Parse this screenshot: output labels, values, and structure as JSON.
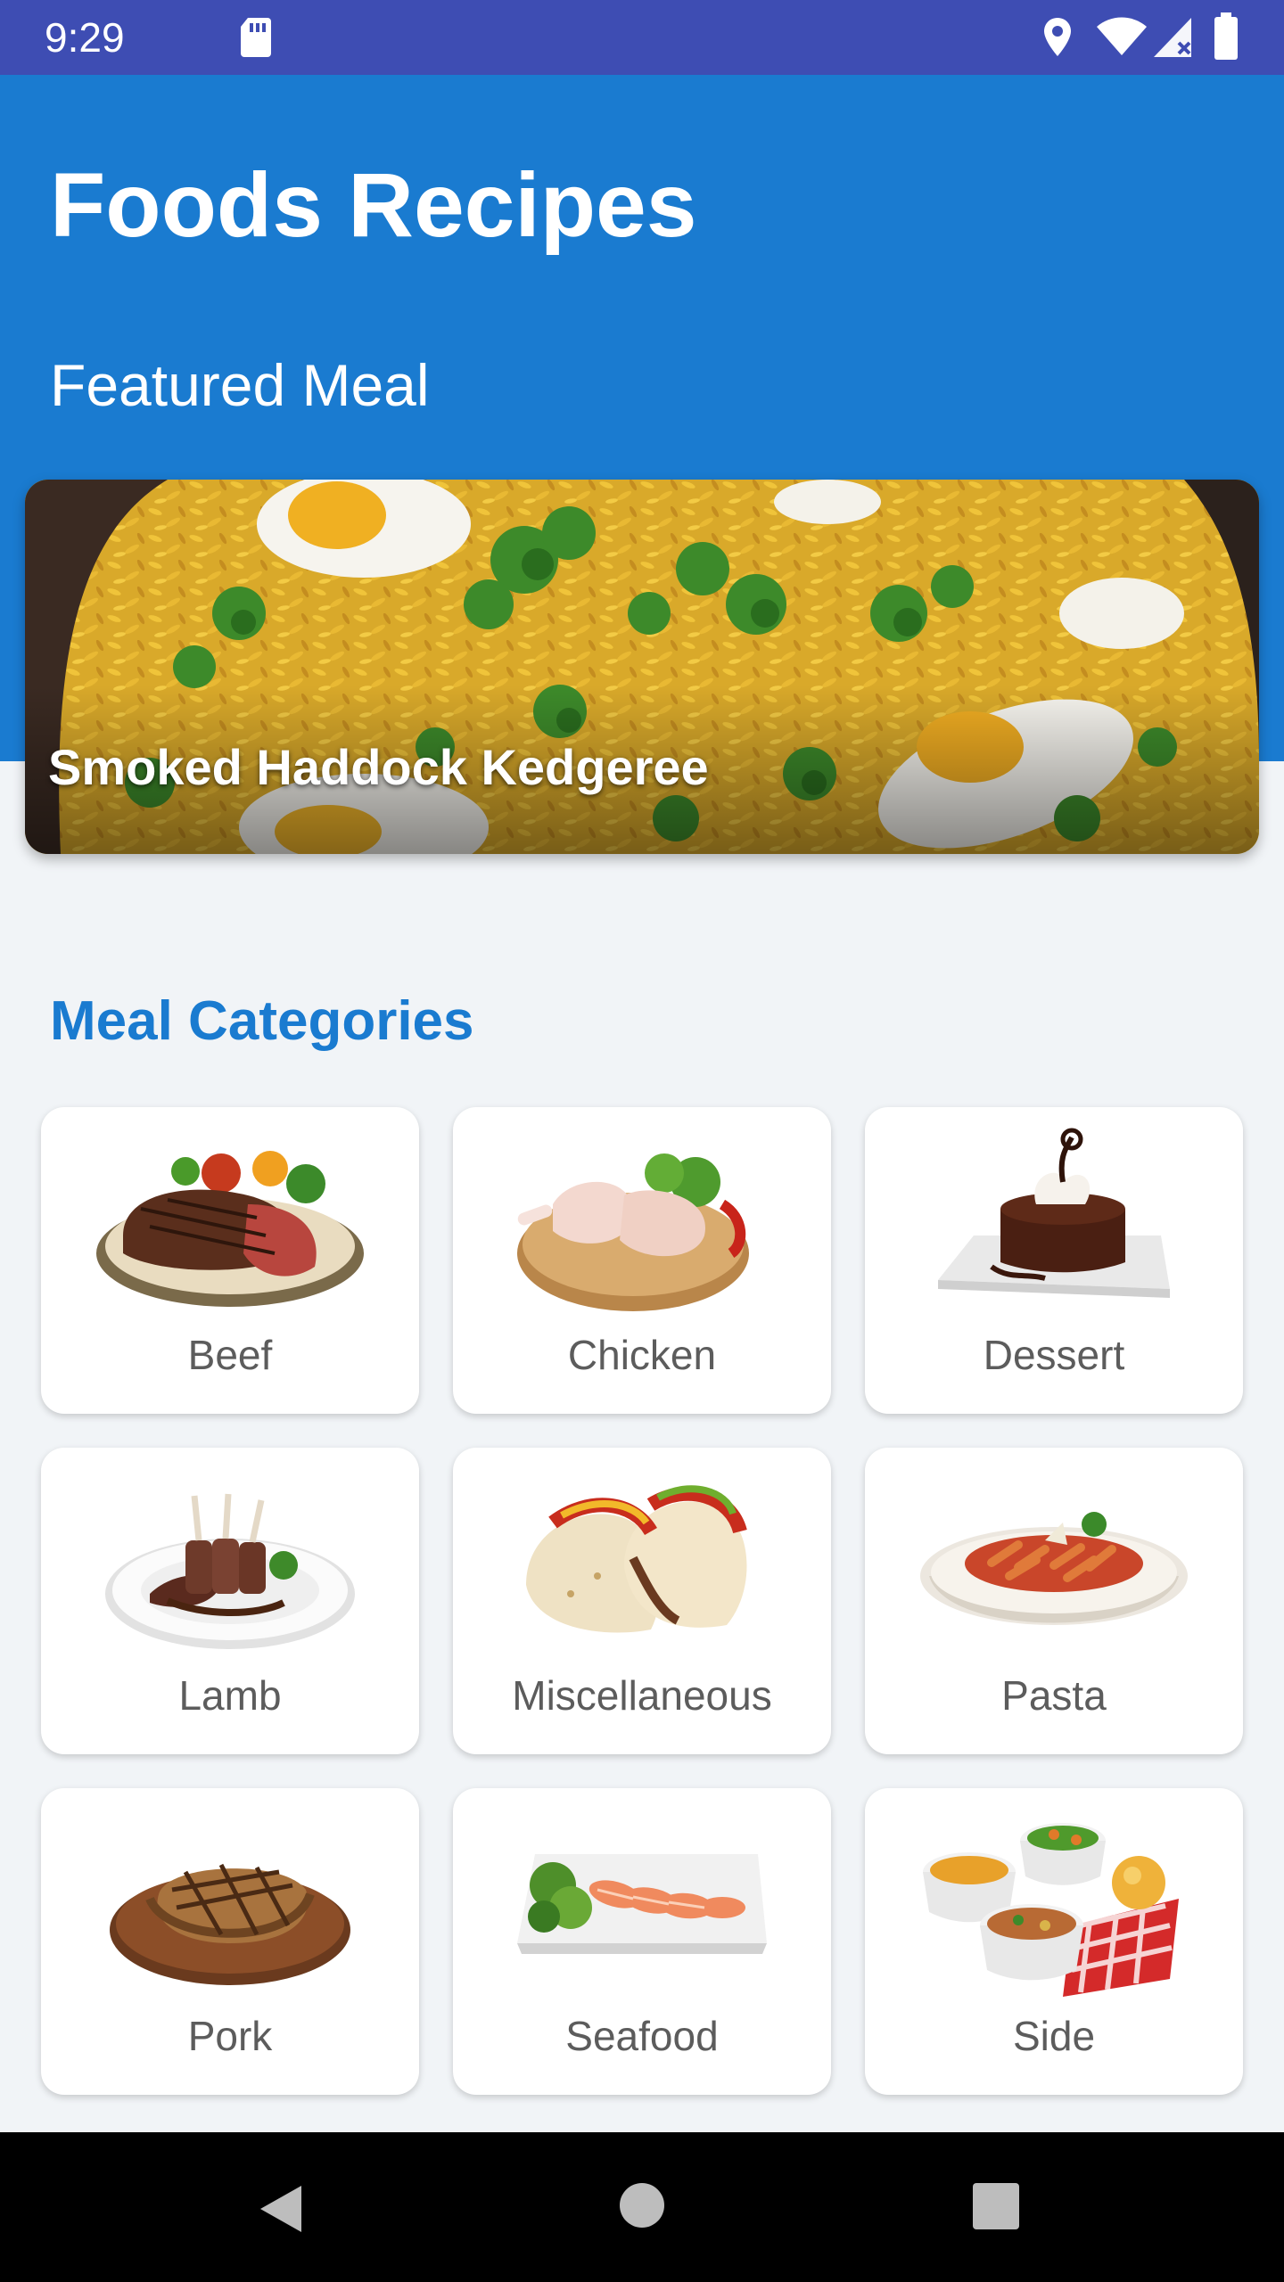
{
  "status_bar": {
    "time": "9:29",
    "icons": [
      "sd-card-icon",
      "location-icon",
      "wifi-icon",
      "signal-icon",
      "battery-icon"
    ]
  },
  "header": {
    "app_title": "Foods Recipes",
    "featured_label": "Featured Meal"
  },
  "featured_meal": {
    "name": "Smoked Haddock Kedgeree"
  },
  "categories": {
    "title": "Meal Categories",
    "items": [
      {
        "label": "Beef",
        "icon": "beef-image"
      },
      {
        "label": "Chicken",
        "icon": "chicken-image"
      },
      {
        "label": "Dessert",
        "icon": "dessert-image"
      },
      {
        "label": "Lamb",
        "icon": "lamb-image"
      },
      {
        "label": "Miscellaneous",
        "icon": "tacos-image"
      },
      {
        "label": "Pasta",
        "icon": "pasta-image"
      },
      {
        "label": "Pork",
        "icon": "pork-image"
      },
      {
        "label": "Seafood",
        "icon": "seafood-image"
      },
      {
        "label": "Side",
        "icon": "side-dishes-image"
      }
    ]
  },
  "nav_bar": {
    "buttons": [
      "back-icon",
      "home-icon",
      "recents-icon"
    ]
  },
  "colors": {
    "status_bar": "#3e4db3",
    "header": "#1a7bd0",
    "accent": "#1a7bd0",
    "background": "#f1f4f7"
  }
}
